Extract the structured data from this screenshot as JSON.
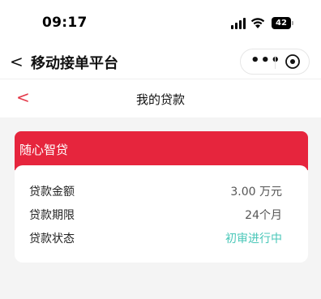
{
  "status_bar": {
    "time": "09:17",
    "battery": "42"
  },
  "nav": {
    "back_symbol": "<",
    "title": "移动接单平台",
    "more_symbol": "•••"
  },
  "page": {
    "back_symbol": "<",
    "title": "我的贷款"
  },
  "loan_card": {
    "product_name": "随心智贷",
    "rows": [
      {
        "label": "贷款金额",
        "value": "3.00 万元"
      },
      {
        "label": "贷款期限",
        "value": "24个月"
      },
      {
        "label": "贷款状态",
        "value": "初审进行中"
      }
    ],
    "status_color": "#49c7b8",
    "accent_color": "#e6253d"
  }
}
